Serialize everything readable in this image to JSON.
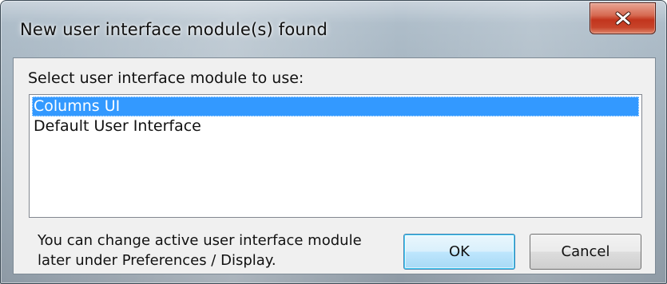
{
  "window": {
    "title": "New user interface module(s) found",
    "close_icon": "close-icon",
    "close_color": "#c7442a"
  },
  "dialog": {
    "prompt": "Select user interface module to use:",
    "modules": [
      {
        "label": "Columns UI",
        "selected": true
      },
      {
        "label": "Default User Interface",
        "selected": false
      }
    ],
    "note_line1": "You can change active user interface module",
    "note_line2": "later under Preferences / Display.",
    "ok_label": "OK",
    "cancel_label": "Cancel",
    "selection_color": "#3399ff"
  }
}
